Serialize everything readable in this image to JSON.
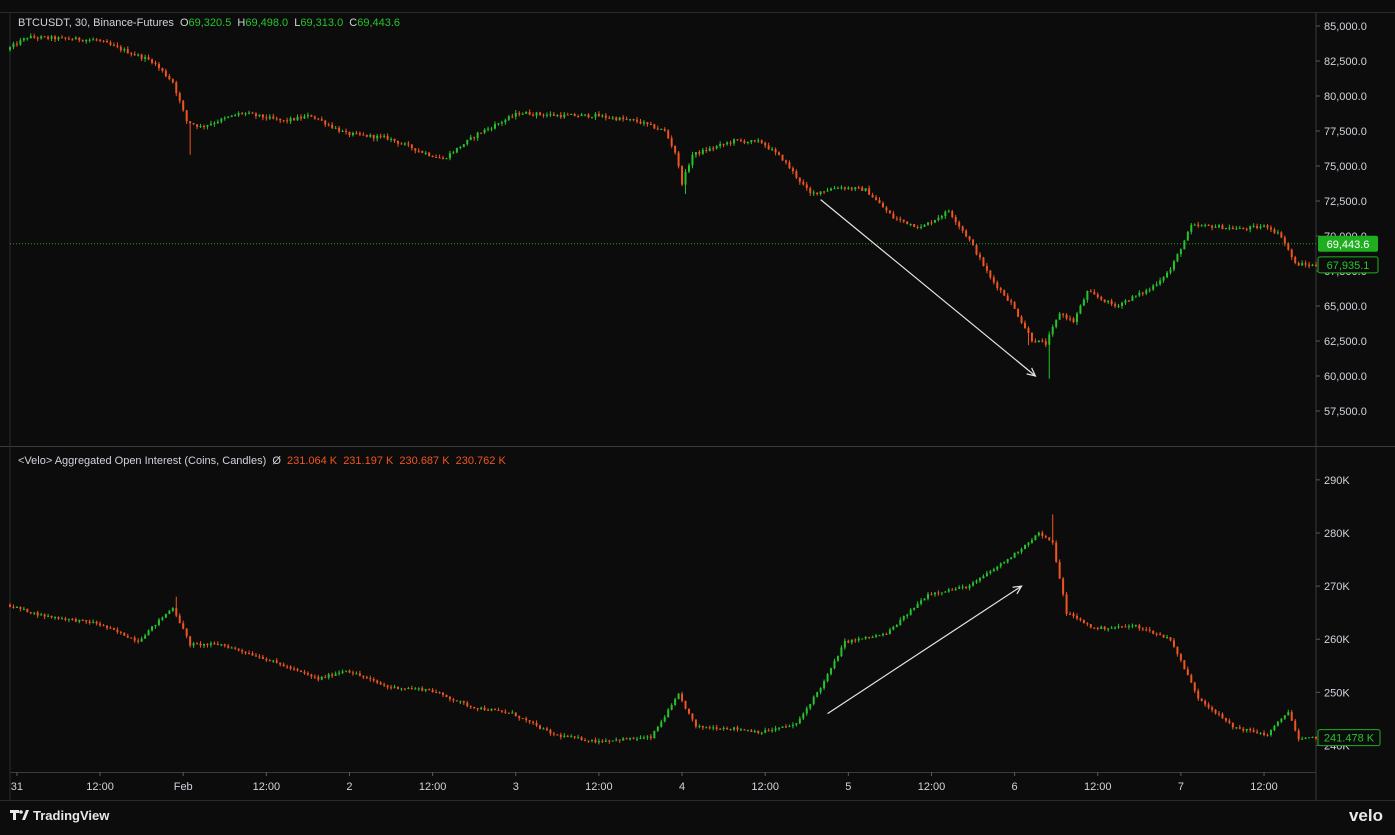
{
  "header": {
    "symbol": "BTCUSDT, 30, Binance-Futures",
    "o_label": "O",
    "o_value": "69,320.5",
    "h_label": "H",
    "h_value": "69,498.0",
    "l_label": "L",
    "l_value": "69,313.0",
    "c_label": "C",
    "c_value": "69,443.6"
  },
  "oi_header": {
    "title": "<Velo> Aggregated Open Interest (Coins, Candles)",
    "symbol": "Ø",
    "values": [
      "231.064 K",
      "231.197 K",
      "230.687 K",
      "230.762 K"
    ]
  },
  "brand": {
    "tradingview": "TradingView",
    "velo": "velo"
  },
  "colors": {
    "background": "#0c0c0c",
    "up": "#26c42c",
    "down": "#f0551f",
    "grid_line": "#2a2a2a",
    "axis_text": "#d1d4dc",
    "price_line": "#1fa81f",
    "arrow": "#e6e6e6"
  },
  "chart_data": [
    {
      "type": "candlestick",
      "name": "BTCUSDT price",
      "ylim": [
        55000,
        86000
      ],
      "yticks": [
        57500,
        60000,
        62500,
        65000,
        67500,
        70000,
        72500,
        75000,
        77500,
        80000,
        82500,
        85000
      ],
      "ytick_labels": [
        "57,500.0",
        "60,000.0",
        "62,500.0",
        "65,000.0",
        "67,500.0",
        "70,000.0",
        "72,500.0",
        "75,000.0",
        "77,500.0",
        "80,000.0",
        "82,500.0",
        "85,000.0"
      ],
      "x_labels": [
        "31",
        "12:00",
        "Feb",
        "12:00",
        "2",
        "12:00",
        "3",
        "12:00",
        "4",
        "12:00",
        "5",
        "12:00",
        "6",
        "12:00",
        "7",
        "12:00"
      ],
      "x_start": "2025-01-30T23:00",
      "x_end": "2025-02-07T19:30",
      "anchors": [
        {
          "t": "2025-01-30T23:00",
          "p": 83300
        },
        {
          "t": "2025-01-31T02:00",
          "p": 84200
        },
        {
          "t": "2025-01-31T12:00",
          "p": 84000
        },
        {
          "t": "2025-01-31T20:00",
          "p": 82500
        },
        {
          "t": "2025-01-31T23:00",
          "p": 81000
        },
        {
          "t": "2025-02-01T01:00",
          "p": 78200
        },
        {
          "t": "2025-02-01T03:00",
          "p": 77800
        },
        {
          "t": "2025-02-01T09:00",
          "p": 78800
        },
        {
          "t": "2025-02-01T15:00",
          "p": 78200
        },
        {
          "t": "2025-02-01T19:00",
          "p": 78600
        },
        {
          "t": "2025-02-02T00:00",
          "p": 77300
        },
        {
          "t": "2025-02-02T06:00",
          "p": 77000
        },
        {
          "t": "2025-02-02T11:00",
          "p": 76000
        },
        {
          "t": "2025-02-02T14:00",
          "p": 75500
        },
        {
          "t": "2025-02-02T19:00",
          "p": 77300
        },
        {
          "t": "2025-02-03T01:00",
          "p": 78800
        },
        {
          "t": "2025-02-03T07:00",
          "p": 78600
        },
        {
          "t": "2025-02-03T12:00",
          "p": 78600
        },
        {
          "t": "2025-02-03T18:00",
          "p": 78200
        },
        {
          "t": "2025-02-03T22:00",
          "p": 77500
        },
        {
          "t": "2025-02-03T23:30",
          "p": 76000
        },
        {
          "t": "2025-02-04T00:30",
          "p": 73800
        },
        {
          "t": "2025-02-04T02:00",
          "p": 75800
        },
        {
          "t": "2025-02-04T08:00",
          "p": 76800
        },
        {
          "t": "2025-02-04T12:00",
          "p": 76700
        },
        {
          "t": "2025-02-04T15:00",
          "p": 75500
        },
        {
          "t": "2025-02-04T19:00",
          "p": 73000
        },
        {
          "t": "2025-02-04T23:00",
          "p": 73500
        },
        {
          "t": "2025-02-05T03:00",
          "p": 73300
        },
        {
          "t": "2025-02-05T07:00",
          "p": 71300
        },
        {
          "t": "2025-02-05T11:00",
          "p": 70600
        },
        {
          "t": "2025-02-05T15:00",
          "p": 71800
        },
        {
          "t": "2025-02-05T18:00",
          "p": 69700
        },
        {
          "t": "2025-02-05T21:00",
          "p": 67000
        },
        {
          "t": "2025-02-06T00:00",
          "p": 65200
        },
        {
          "t": "2025-02-06T03:00",
          "p": 62600
        },
        {
          "t": "2025-02-06T05:00",
          "p": 62300
        },
        {
          "t": "2025-02-06T07:00",
          "p": 64500
        },
        {
          "t": "2025-02-06T09:00",
          "p": 63900
        },
        {
          "t": "2025-02-06T11:00",
          "p": 66000
        },
        {
          "t": "2025-02-06T15:00",
          "p": 65000
        },
        {
          "t": "2025-02-06T20:00",
          "p": 66200
        },
        {
          "t": "2025-02-06T23:00",
          "p": 67600
        },
        {
          "t": "2025-02-07T02:00",
          "p": 70700
        },
        {
          "t": "2025-02-07T05:00",
          "p": 70700
        },
        {
          "t": "2025-02-07T09:00",
          "p": 70500
        },
        {
          "t": "2025-02-07T13:00",
          "p": 70700
        },
        {
          "t": "2025-02-07T15:00",
          "p": 70000
        },
        {
          "t": "2025-02-07T17:00",
          "p": 68000
        },
        {
          "t": "2025-02-07T19:30",
          "p": 67900
        }
      ],
      "spikes": [
        {
          "t": "2025-02-01T01:00",
          "low": 75800
        },
        {
          "t": "2025-02-04T00:30",
          "low": 73000
        },
        {
          "t": "2025-02-06T05:00",
          "low": 59800
        },
        {
          "t": "2025-02-06T02:00",
          "low": 62200
        }
      ],
      "last_price": 69443.6,
      "last_label": "69,443.6",
      "second_label": "67,935.1",
      "second_price": 67935.1,
      "annotation": {
        "type": "arrow",
        "from": {
          "t": "2025-02-04T20:00",
          "p": 72600
        },
        "to": {
          "t": "2025-02-06T03:00",
          "p": 60000
        }
      }
    },
    {
      "type": "candlestick",
      "name": "Aggregated Open Interest",
      "ylim": [
        235000,
        296000
      ],
      "yticks": [
        240000,
        250000,
        260000,
        270000,
        280000,
        290000
      ],
      "ytick_labels": [
        "240K",
        "250K",
        "260K",
        "270K",
        "280K",
        "290K"
      ],
      "anchors": [
        {
          "t": "2025-01-30T23:00",
          "p": 266500
        },
        {
          "t": "2025-01-31T04:00",
          "p": 264500
        },
        {
          "t": "2025-01-31T12:00",
          "p": 263000
        },
        {
          "t": "2025-01-31T18:00",
          "p": 259700
        },
        {
          "t": "2025-01-31T23:00",
          "p": 266000
        },
        {
          "t": "2025-02-01T01:30",
          "p": 259000
        },
        {
          "t": "2025-02-01T06:00",
          "p": 259000
        },
        {
          "t": "2025-02-01T12:00",
          "p": 256500
        },
        {
          "t": "2025-02-01T20:00",
          "p": 252500
        },
        {
          "t": "2025-02-02T00:00",
          "p": 254200
        },
        {
          "t": "2025-02-02T06:00",
          "p": 251000
        },
        {
          "t": "2025-02-02T12:00",
          "p": 250500
        },
        {
          "t": "2025-02-02T18:00",
          "p": 247300
        },
        {
          "t": "2025-02-03T00:00",
          "p": 246000
        },
        {
          "t": "2025-02-03T06:00",
          "p": 242000
        },
        {
          "t": "2025-02-03T12:00",
          "p": 240800
        },
        {
          "t": "2025-02-03T20:00",
          "p": 241500
        },
        {
          "t": "2025-02-04T00:00",
          "p": 249500
        },
        {
          "t": "2025-02-04T02:30",
          "p": 243500
        },
        {
          "t": "2025-02-04T08:00",
          "p": 243200
        },
        {
          "t": "2025-02-04T12:00",
          "p": 242500
        },
        {
          "t": "2025-02-04T17:00",
          "p": 244000
        },
        {
          "t": "2025-02-04T21:00",
          "p": 252000
        },
        {
          "t": "2025-02-05T00:00",
          "p": 259500
        },
        {
          "t": "2025-02-05T06:00",
          "p": 261000
        },
        {
          "t": "2025-02-05T12:00",
          "p": 268500
        },
        {
          "t": "2025-02-05T18:00",
          "p": 270000
        },
        {
          "t": "2025-02-06T00:00",
          "p": 275500
        },
        {
          "t": "2025-02-06T04:00",
          "p": 280000
        },
        {
          "t": "2025-02-06T06:00",
          "p": 278000
        },
        {
          "t": "2025-02-06T08:00",
          "p": 265000
        },
        {
          "t": "2025-02-06T12:00",
          "p": 262000
        },
        {
          "t": "2025-02-06T18:00",
          "p": 262500
        },
        {
          "t": "2025-02-06T23:00",
          "p": 260000
        },
        {
          "t": "2025-02-07T03:00",
          "p": 249000
        },
        {
          "t": "2025-02-07T08:00",
          "p": 243500
        },
        {
          "t": "2025-02-07T13:00",
          "p": 242000
        },
        {
          "t": "2025-02-07T16:00",
          "p": 246500
        },
        {
          "t": "2025-02-07T17:30",
          "p": 241000
        },
        {
          "t": "2025-02-07T19:30",
          "p": 241500
        }
      ],
      "spikes": [
        {
          "t": "2025-02-06T05:30",
          "high": 283500
        },
        {
          "t": "2025-01-31T23:00",
          "high": 268000
        }
      ],
      "last_label": "241.478 K",
      "last_value": 241478,
      "annotation": {
        "type": "arrow",
        "from": {
          "t": "2025-02-04T21:00",
          "p": 246000
        },
        "to": {
          "t": "2025-02-06T01:00",
          "p": 270000
        }
      }
    }
  ]
}
